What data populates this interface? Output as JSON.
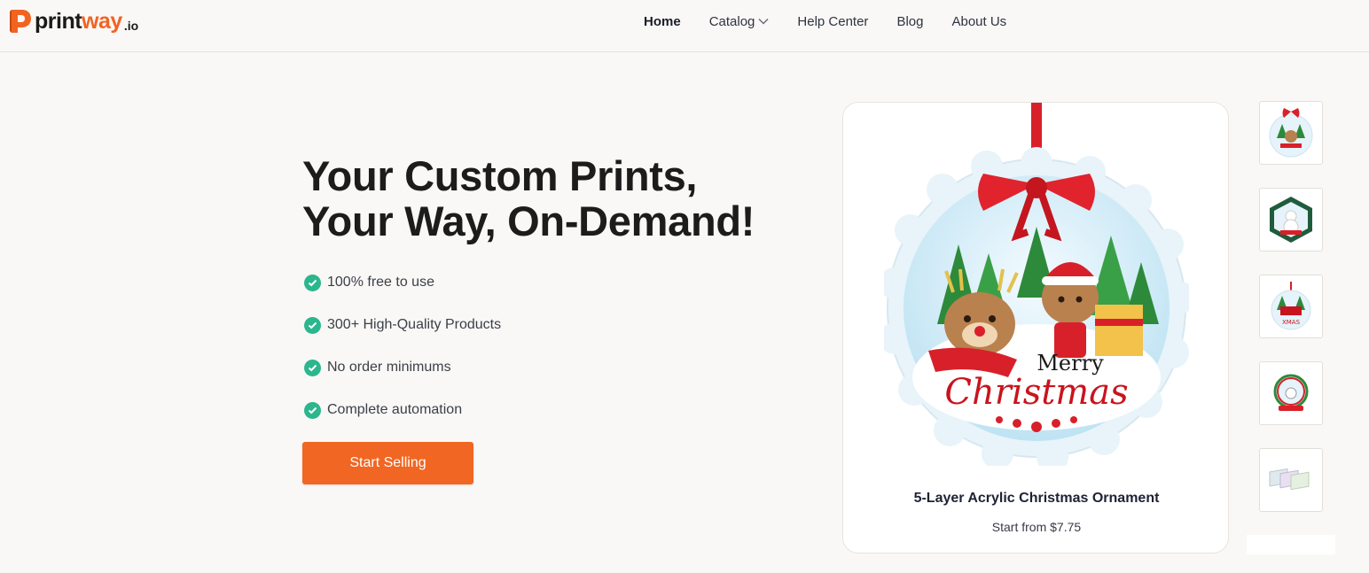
{
  "brand": {
    "name_part1": "print",
    "name_part2": "way",
    "suffix": ".io",
    "accent": "#f26322"
  },
  "nav": {
    "items": [
      {
        "label": "Home",
        "active": true
      },
      {
        "label": "Catalog",
        "has_dropdown": true
      },
      {
        "label": "Help Center"
      },
      {
        "label": "Blog"
      },
      {
        "label": "About Us"
      }
    ]
  },
  "hero": {
    "title_line1": "Your Custom Prints,",
    "title_line2": "Your Way, On-Demand!",
    "features": [
      "100% free to use",
      "300+ High-Quality Products",
      "No order minimums",
      "Complete automation"
    ],
    "cta_label": "Start Selling",
    "cta_color": "#f16622",
    "check_color": "#2bb68e"
  },
  "product": {
    "name": "5-Layer Acrylic Christmas Ornament",
    "price": "Start from $7.75",
    "image_text_line1": "Merry",
    "image_text_line2": "Christmas",
    "image_icon": "christmas-ornament-reindeer"
  },
  "thumbnails": [
    {
      "icon": "ornament-round-santa-icon"
    },
    {
      "icon": "ornament-hexagon-snowman-icon"
    },
    {
      "icon": "ornament-round-truck-icon"
    },
    {
      "icon": "ornament-snowglobe-icon"
    },
    {
      "icon": "acrylic-layers-icon"
    }
  ]
}
